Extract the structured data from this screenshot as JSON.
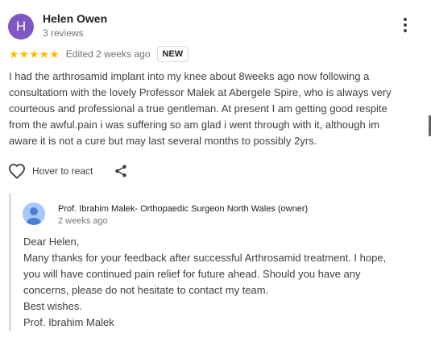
{
  "reviewer": {
    "initial": "H",
    "name": "Helen Owen",
    "reviews": "3 reviews",
    "avatar_color": "#7e57c2"
  },
  "rating": {
    "stars": "★★★★★",
    "value": 5,
    "max": 5,
    "edited": "Edited 2 weeks ago",
    "badge": "NEW",
    "star_color": "#fbbc04"
  },
  "review": {
    "lines": [
      "I had the arthrosamid implant into my knee about 8weeks ago now following a",
      "consultatiom with the lovely Professor Malek at Abergele Spire, who is always very",
      "courteous and professional a true gentleman. At present I am getting good respite",
      "from the awful.pain i was suffering so am glad i went through with it, although im",
      "aware it is not a cure but may last several months to possibly 2yrs."
    ]
  },
  "actions": {
    "react_label": "Hover to react",
    "icons": [
      "heart-icon",
      "share-icon",
      "more-vert-icon"
    ]
  },
  "owner_reply": {
    "name": "Prof. Ibrahim Malek- Orthopaedic Surgeon North Wales (owner)",
    "date": "2 weeks ago",
    "lines": [
      "Dear Helen,",
      "Many thanks for your feedback after successful Arthrosamid treatment. I hope,",
      "you will have continued pain relief for future ahead. Should you have any",
      "concerns, please do not hesitate to contact my team.",
      "Best wishes.",
      "Prof. Ibrahim Malek"
    ]
  }
}
